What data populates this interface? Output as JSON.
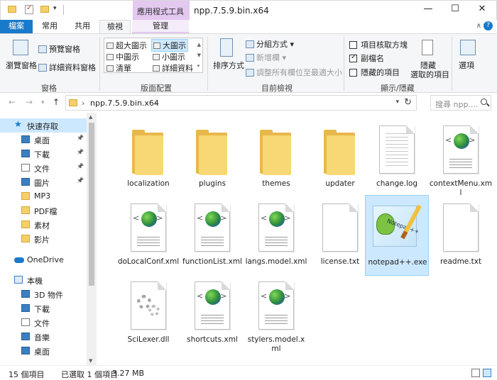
{
  "window": {
    "title": "npp.7.5.9.bin.x64",
    "context_group": "應用程式工具",
    "minimize": "—",
    "maximize": "☐",
    "close": "✕"
  },
  "tabs": {
    "file": "檔案",
    "home": "常用",
    "share": "共用",
    "view": "檢視",
    "manage": "管理"
  },
  "ribbon": {
    "pane": {
      "nav_pane": "瀏覽窗格",
      "preview_pane": "預覽窗格",
      "details_pane": "詳細資料窗格",
      "group_label": "窗格"
    },
    "layout": {
      "items": [
        "超大圖示",
        "大圖示",
        "中圖示",
        "小圖示",
        "清單",
        "詳細資料"
      ],
      "selected": "大圖示",
      "group_label": "版面配置"
    },
    "current_view": {
      "sort_by": "排序方式",
      "group_by": "分組方式",
      "add_columns": "新增欄",
      "size_columns": "調整所有欄位至最適大小",
      "group_label": "目前檢視"
    },
    "show_hide": {
      "item_checkboxes": "項目核取方塊",
      "file_extensions": "副檔名",
      "hidden_items": "隱藏的項目",
      "hide_selected_line1": "隱藏",
      "hide_selected_line2": "選取的項目",
      "group_label": "顯示/隱藏",
      "item_checkboxes_checked": false,
      "file_extensions_checked": true,
      "hidden_items_checked": false
    },
    "options": "選項"
  },
  "address": {
    "path": "npp.7.5.9.bin.x64",
    "search_placeholder": "搜尋 npp...."
  },
  "nav": {
    "items": [
      {
        "label": "快速存取",
        "icon": "star-icon"
      },
      {
        "label": "桌面",
        "icon": "desktop-icon",
        "pinned": true
      },
      {
        "label": "下載",
        "icon": "download-icon",
        "pinned": true
      },
      {
        "label": "文件",
        "icon": "documents-icon",
        "pinned": true
      },
      {
        "label": "圖片",
        "icon": "pictures-icon",
        "pinned": true
      },
      {
        "label": "MP3",
        "icon": "folder-icon"
      },
      {
        "label": "PDF檔",
        "icon": "folder-icon"
      },
      {
        "label": "素材",
        "icon": "folder-icon"
      },
      {
        "label": "影片",
        "icon": "folder-icon"
      },
      {
        "label": "OneDrive",
        "icon": "onedrive-icon"
      },
      {
        "label": "本機",
        "icon": "this-pc-icon"
      },
      {
        "label": "3D 物件",
        "icon": "3d-objects-icon"
      },
      {
        "label": "下載",
        "icon": "download-icon"
      },
      {
        "label": "文件",
        "icon": "documents-icon"
      },
      {
        "label": "音樂",
        "icon": "music-icon"
      },
      {
        "label": "桌面",
        "icon": "desktop-icon"
      }
    ],
    "pin_glyph": "📌"
  },
  "files": [
    {
      "name": "localization",
      "type": "folder"
    },
    {
      "name": "plugins",
      "type": "folder"
    },
    {
      "name": "themes",
      "type": "folder"
    },
    {
      "name": "updater",
      "type": "folder"
    },
    {
      "name": "change.log",
      "type": "log"
    },
    {
      "name": "contextMenu.xml",
      "type": "xml"
    },
    {
      "name": "doLocalConf.xml",
      "type": "xml"
    },
    {
      "name": "functionList.xml",
      "type": "xml"
    },
    {
      "name": "langs.model.xml",
      "type": "xml"
    },
    {
      "name": "license.txt",
      "type": "txt"
    },
    {
      "name": "notepad++.exe",
      "type": "exe",
      "selected": true
    },
    {
      "name": "readme.txt",
      "type": "txt"
    },
    {
      "name": "SciLexer.dll",
      "type": "dll"
    },
    {
      "name": "shortcuts.xml",
      "type": "xml"
    },
    {
      "name": "stylers.model.xml",
      "type": "xml"
    }
  ],
  "status": {
    "item_count": "15 個項目",
    "selection": "已選取 1 個項目",
    "size": "3.27 MB"
  }
}
